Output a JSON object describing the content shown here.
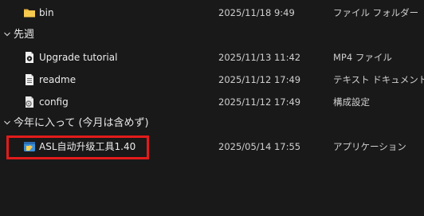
{
  "files": [
    {
      "name": "bin",
      "date": "2025/11/18 9:49",
      "type": "ファイル フォルダー",
      "icon": "folder-icon"
    }
  ],
  "groups": [
    {
      "label": "先週",
      "items": [
        {
          "name": "Upgrade tutorial",
          "date": "2025/11/13 11:42",
          "type": "MP4 ファイル",
          "icon": "video-file-icon"
        },
        {
          "name": "readme",
          "date": "2025/11/12 17:49",
          "type": "テキスト ドキュメント",
          "icon": "text-file-icon"
        },
        {
          "name": "config",
          "date": "2025/11/12 17:49",
          "type": "構成設定",
          "icon": "config-file-icon"
        }
      ]
    },
    {
      "label": "今年に入って (今月は含めず)",
      "items": [
        {
          "name": "ASL自动升级工具1.40",
          "date": "2025/05/14 17:55",
          "type": "アプリケーション",
          "icon": "application-icon"
        }
      ]
    }
  ],
  "colors": {
    "background": "#191919",
    "highlight": "#e21b1b",
    "folder": "#f2c14e"
  }
}
